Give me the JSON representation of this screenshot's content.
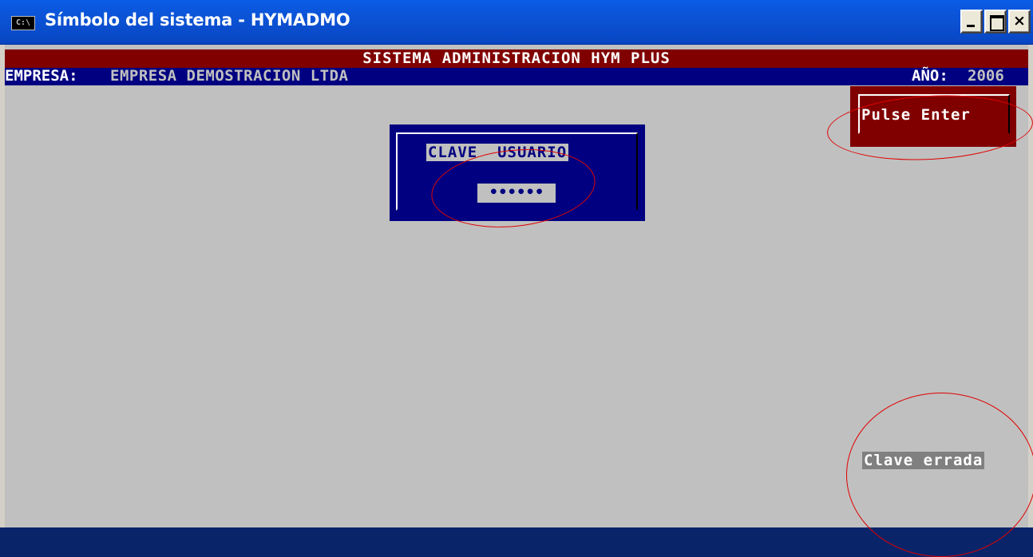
{
  "window": {
    "title": "Símbolo del sistema - HYMADMO",
    "icon_text": "C:\\",
    "icon": "console-icon",
    "controls": {
      "minimize": "minimize-icon",
      "maximize": "maximize-icon",
      "close": "×"
    }
  },
  "header": {
    "system_title": "SISTEMA ADMINISTRACION HYM PLUS",
    "empresa_label": "EMPRESA:",
    "empresa_value": "EMPRESA DEMOSTRACION LTDA",
    "anio_label": "AÑO:",
    "anio_value": "2006"
  },
  "prompt": {
    "pulse_enter": "Pulse Enter"
  },
  "login": {
    "label": "CLAVE  USUARIO",
    "password_masked": "••••••"
  },
  "status": {
    "error": "Clave errada"
  },
  "colors": {
    "console_bg": "#c0c0c0",
    "header_red": "#800000",
    "header_blue": "#000080",
    "annotation": "#e00000"
  }
}
